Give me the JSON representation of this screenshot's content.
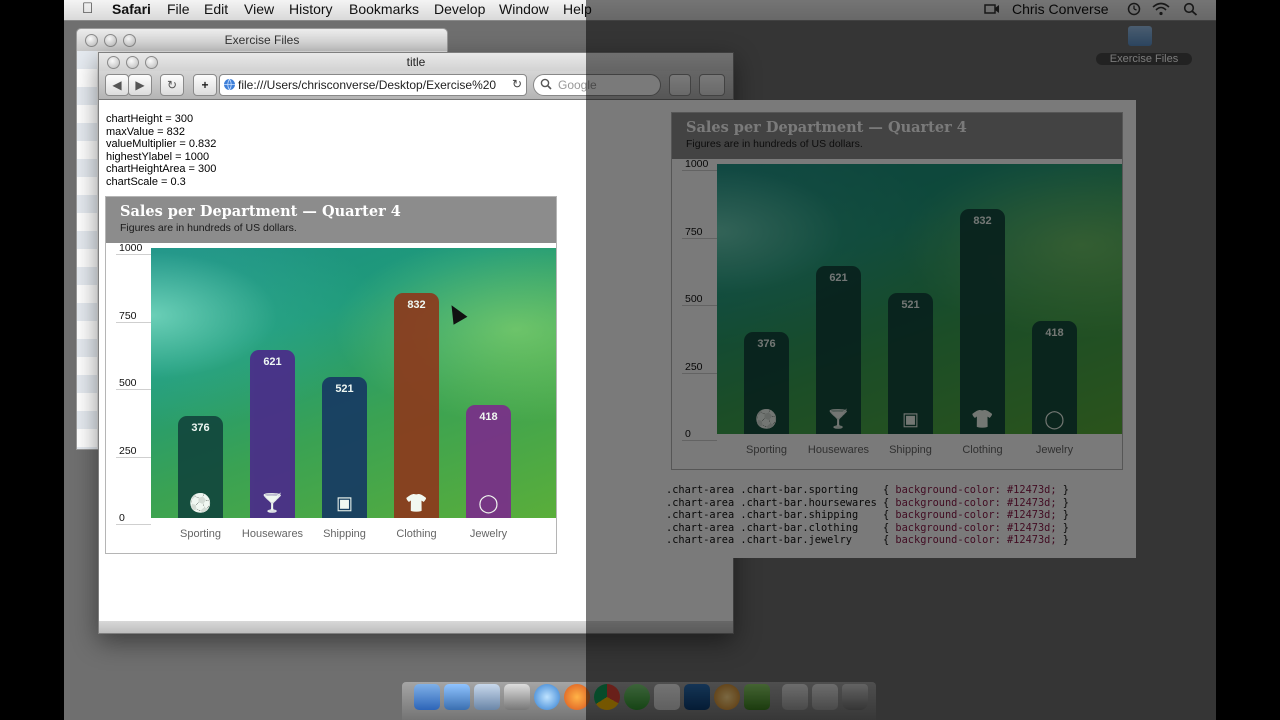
{
  "menubar": {
    "app": "Safari",
    "items": [
      "File",
      "Edit",
      "View",
      "History",
      "Bookmarks",
      "Develop",
      "Window",
      "Help"
    ],
    "user": "Chris Converse"
  },
  "desktop": {
    "folder_label": "Exercise Files"
  },
  "finder": {
    "title": "Exercise Files"
  },
  "browser": {
    "title": "title",
    "url": "file:///Users/chrisconverse/Desktop/Exercise%20",
    "search_placeholder": "Google",
    "back": "◀",
    "forward": "▶",
    "reload": "↻",
    "add": "+"
  },
  "variables": [
    "chartHeight = 300",
    "maxValue = 832",
    "valueMultiplier = 0.832",
    "highestYlabel = 1000",
    "chartHeightArea = 300",
    "chartScale = 0.3"
  ],
  "chart_data": [
    {
      "type": "bar",
      "title": "Sales per Department — Quarter 4",
      "subtitle": "Figures are in hundreds of US dollars.",
      "categories": [
        "Sporting",
        "Housewares",
        "Shipping",
        "Clothing",
        "Jewelry"
      ],
      "values": [
        376,
        621,
        521,
        832,
        418
      ],
      "y_ticks": [
        "1000",
        "750",
        "500",
        "250",
        "0"
      ],
      "ylim": [
        0,
        1000
      ],
      "bar_colors": [
        "#12473d",
        "#4b2b8a",
        "#173a63",
        "#8c3a1d",
        "#7a2e8a"
      ],
      "icons": [
        "soccer-ball-icon",
        "martini-glass-icon",
        "box-icon",
        "tshirt-icon",
        "ring-icon"
      ],
      "grid": true
    },
    {
      "type": "bar",
      "title": "Sales per Department — Quarter 4",
      "subtitle": "Figures are in hundreds of US dollars.",
      "categories": [
        "Sporting",
        "Housewares",
        "Shipping",
        "Clothing",
        "Jewelry"
      ],
      "values": [
        376,
        621,
        521,
        832,
        418
      ],
      "y_ticks": [
        "1000",
        "750",
        "500",
        "250",
        "0"
      ],
      "ylim": [
        0,
        1000
      ],
      "bar_colors": [
        "#12473d",
        "#12473d",
        "#12473d",
        "#12473d",
        "#12473d"
      ],
      "icons": [
        "soccer-ball-icon",
        "martini-glass-icon",
        "box-icon",
        "tshirt-icon",
        "ring-icon"
      ],
      "grid": true
    }
  ],
  "code": {
    "lines": [
      {
        "selector": ".chart-area .chart-bar.sporting    ",
        "open": "{ ",
        "prop": "background-color: #12473d;",
        "close": " }"
      },
      {
        "selector": ".chart-area .chart-bar.hoursewares ",
        "open": "{ ",
        "prop": "background-color: #12473d;",
        "close": " }"
      },
      {
        "selector": ".chart-area .chart-bar.shipping    ",
        "open": "{ ",
        "prop": "background-color: #12473d;",
        "close": " }"
      },
      {
        "selector": ".chart-area .chart-bar.clothing    ",
        "open": "{ ",
        "prop": "background-color: #12473d;",
        "close": " }"
      },
      {
        "selector": ".chart-area .chart-bar.jewelry     ",
        "open": "{ ",
        "prop": "background-color: #12473d;",
        "close": " }"
      }
    ]
  },
  "icon_glyphs": {
    "soccer-ball-icon": "⚽",
    "martini-glass-icon": "🍸",
    "box-icon": "▣",
    "tshirt-icon": "👕",
    "ring-icon": "◯"
  }
}
